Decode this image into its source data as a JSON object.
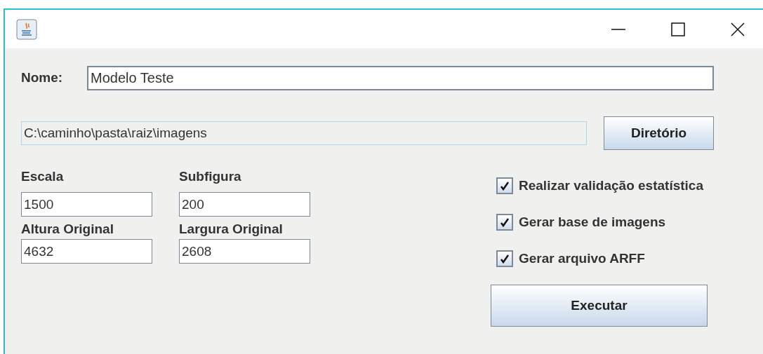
{
  "name_field": {
    "label": "Nome:",
    "value": "Modelo Teste"
  },
  "path_field": {
    "value": "C:\\caminho\\pasta\\raiz\\imagens",
    "disabled": true
  },
  "directory_button": {
    "label": "Diretório"
  },
  "params": [
    {
      "label": "Escala",
      "value": "1500"
    },
    {
      "label": "Subfigura",
      "value": "200"
    },
    {
      "label": "Altura Original",
      "value": "4632"
    },
    {
      "label": "Largura Original",
      "value": "2608"
    }
  ],
  "options": [
    {
      "label": "Realizar validação estatística",
      "checked": true
    },
    {
      "label": "Gerar base de imagens",
      "checked": true
    },
    {
      "label": "Gerar arquivo ARFF",
      "checked": true
    }
  ],
  "run_button": {
    "label": "Executar"
  }
}
